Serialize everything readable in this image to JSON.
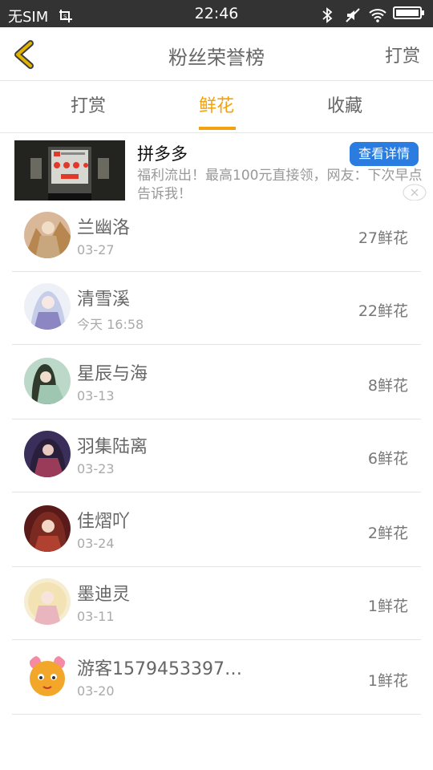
{
  "status_bar": {
    "carrier": "无SIM",
    "time": "22:46"
  },
  "header": {
    "title": "粉丝荣誉榜",
    "right_action": "打赏"
  },
  "tabs": [
    {
      "label": "打赏",
      "active": false
    },
    {
      "label": "鲜花",
      "active": true
    },
    {
      "label": "收藏",
      "active": false
    }
  ],
  "ad": {
    "title": "拼多多",
    "button": "查看详情",
    "description": "福利流出！最高100元直接领，网友：下次早点告诉我！"
  },
  "colors": {
    "accent": "#f2a20c",
    "ad_button": "#2a7ce0",
    "status_bar": "#333333"
  },
  "fans": [
    {
      "name": "兰幽洛",
      "date": "03-27",
      "count": "27鲜花"
    },
    {
      "name": "清雪溪",
      "date": "今天 16:58",
      "count": "22鲜花"
    },
    {
      "name": "星辰与海",
      "date": "03-13",
      "count": "8鲜花"
    },
    {
      "name": "羽集陆离",
      "date": "03-23",
      "count": "6鲜花"
    },
    {
      "name": "佳熠吖",
      "date": "03-24",
      "count": "2鲜花"
    },
    {
      "name": "墨迪灵",
      "date": "03-11",
      "count": "1鲜花"
    },
    {
      "name": "游客1579453397…",
      "date": "03-20",
      "count": "1鲜花"
    }
  ]
}
